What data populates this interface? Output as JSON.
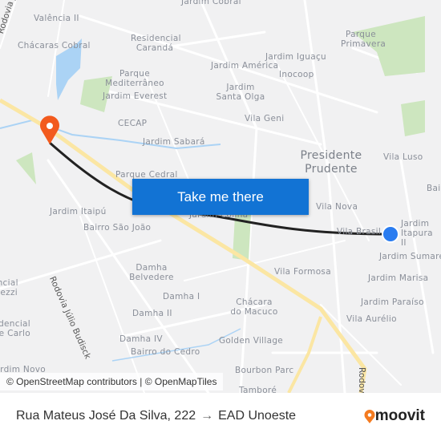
{
  "map": {
    "labels": [
      "Valência II",
      "Chácaras Cobral",
      "Residencial Carandá",
      "Jardim Cobral",
      "Jardim América",
      "Jardim Iguaçu",
      "Inocoop",
      "Parque Primavera",
      "Parque Mediterrâneo",
      "Jardim Everest",
      "Jardim Santa Olga",
      "CECAP",
      "Vila Geni",
      "Jardim Sabará",
      "Vila Luso",
      "Parque Cedral",
      "Jardim Itaipú",
      "Bairro São João",
      "Jardim Colina",
      "Vila Nova",
      "Vila Brasil",
      "Jardim Itapura II",
      "Jardim Sumaré",
      "Jardim Marisa",
      "Vila Formosa",
      "Damha Belvedere",
      "Damha I",
      "Damha II",
      "Chácara do Macuco",
      "Jardim Paraíso",
      "Vila Aurélio",
      "Damha IV",
      "Bairro do Cedro",
      "Golden Village",
      "Bourbon Parc",
      "Tamboré",
      "Residencial Azezzi",
      "Residencial Monte Carlo",
      "Jardim Novo",
      "Bai"
    ],
    "city": "Presidente Prudente",
    "roads": [
      "Rodovia Júlio Budisck",
      "Rodovia Júlio Budisck",
      "Rodov"
    ],
    "colors": {
      "route": "#222222",
      "origin": "#2a7cf0",
      "destination": "#f25a1d",
      "highway": "#fbe6a3",
      "water": "#abd3f5",
      "park": "#cde6bf"
    }
  },
  "cta": {
    "label": "Take me there"
  },
  "attribution": "© OpenStreetMap contributors | © OpenMapTiles",
  "footer": {
    "origin": "Rua Mateus José Da Silva, 222",
    "arrow": "→",
    "destination": "EAD Unoeste",
    "brand": "moovit"
  }
}
